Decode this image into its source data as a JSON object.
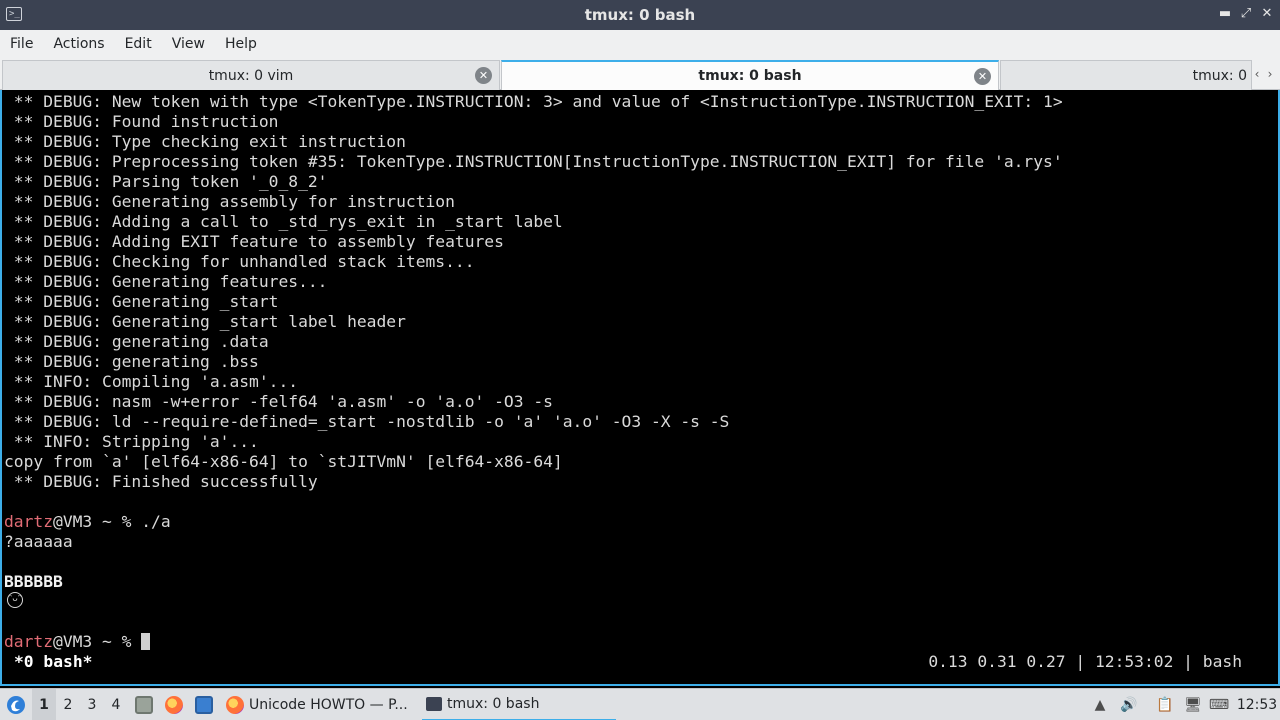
{
  "window": {
    "title": "tmux: 0 bash",
    "app_icon": "terminal-icon",
    "minimize_symbol": "▬",
    "maximize_symbol": "⤢",
    "close_symbol": "✕"
  },
  "menu": [
    "File",
    "Actions",
    "Edit",
    "View",
    "Help"
  ],
  "tabs": [
    {
      "label": "tmux: 0 vim",
      "active": false
    },
    {
      "label": "tmux: 0 bash",
      "active": true
    },
    {
      "label": "tmux: 0",
      "active": false
    }
  ],
  "tab_scroll": {
    "left": "‹",
    "right": "›"
  },
  "tab_close_symbol": "✕",
  "terminal": {
    "lines": [
      " ** DEBUG: New token with type <TokenType.INSTRUCTION: 3> and value of <InstructionType.INSTRUCTION_EXIT: 1>",
      " ** DEBUG: Found instruction",
      " ** DEBUG: Type checking exit instruction",
      " ** DEBUG: Preprocessing token #35: TokenType.INSTRUCTION[InstructionType.INSTRUCTION_EXIT] for file 'a.rys'",
      " ** DEBUG: Parsing token '_0_8_2'",
      " ** DEBUG: Generating assembly for instruction",
      " ** DEBUG: Adding a call to _std_rys_exit in _start label",
      " ** DEBUG: Adding EXIT feature to assembly features",
      " ** DEBUG: Checking for unhandled stack items...",
      " ** DEBUG: Generating features...",
      " ** DEBUG: Generating _start",
      " ** DEBUG: Generating _start label header",
      " ** DEBUG: generating .data",
      " ** DEBUG: generating .bss",
      " ** INFO: Compiling 'a.asm'...",
      " ** DEBUG: nasm -w+error -felf64 'a.asm' -o 'a.o' -O3 -s",
      " ** DEBUG: ld --require-defined=_start -nostdlib -o 'a' 'a.o' -O3 -X -s -S",
      " ** INFO: Stripping 'a'...",
      "copy from `a' [elf64-x86-64] to `stJITVmN' [elf64-x86-64]",
      " ** DEBUG: Finished successfully"
    ],
    "prompt1": {
      "user": "dartz",
      "rest": "@VM3 ~ % ",
      "command": "./a"
    },
    "output1": "?aaaaaa",
    "output2": "BBBBBB",
    "emoji_icon": "grinning-face-icon",
    "emoji_glyph": "😬",
    "prompt2": {
      "user": "dartz",
      "rest": "@VM3 ~ % "
    }
  },
  "tmux_status": {
    "left": "*0 bash*",
    "right": "0.13 0.31 0.27 | 12:53:02 | bash"
  },
  "taskbar": {
    "menu_icon": "start-menu-icon",
    "desktops": [
      "1",
      "2",
      "3",
      "4"
    ],
    "active_desktop": "1",
    "quicklaunch": [
      "file-manager-icon",
      "firefox-icon",
      "show-desktop-icon"
    ],
    "tasks": [
      {
        "label": "Unicode HOWTO — P...",
        "icon": "firefox-icon",
        "active": false
      },
      {
        "label": "tmux: 0 bash",
        "icon": "terminal-icon",
        "active": true
      }
    ],
    "tray": [
      "tray-up-arrow-icon",
      "volume-icon",
      "clipboard-icon",
      "network-icon",
      "keyboard-icon"
    ],
    "clock": "12:53"
  },
  "colors": {
    "accent": "#3daee9",
    "prompt_user": "#e06c75",
    "titlebar": "#3b4252",
    "terminal_bg": "#000000"
  }
}
